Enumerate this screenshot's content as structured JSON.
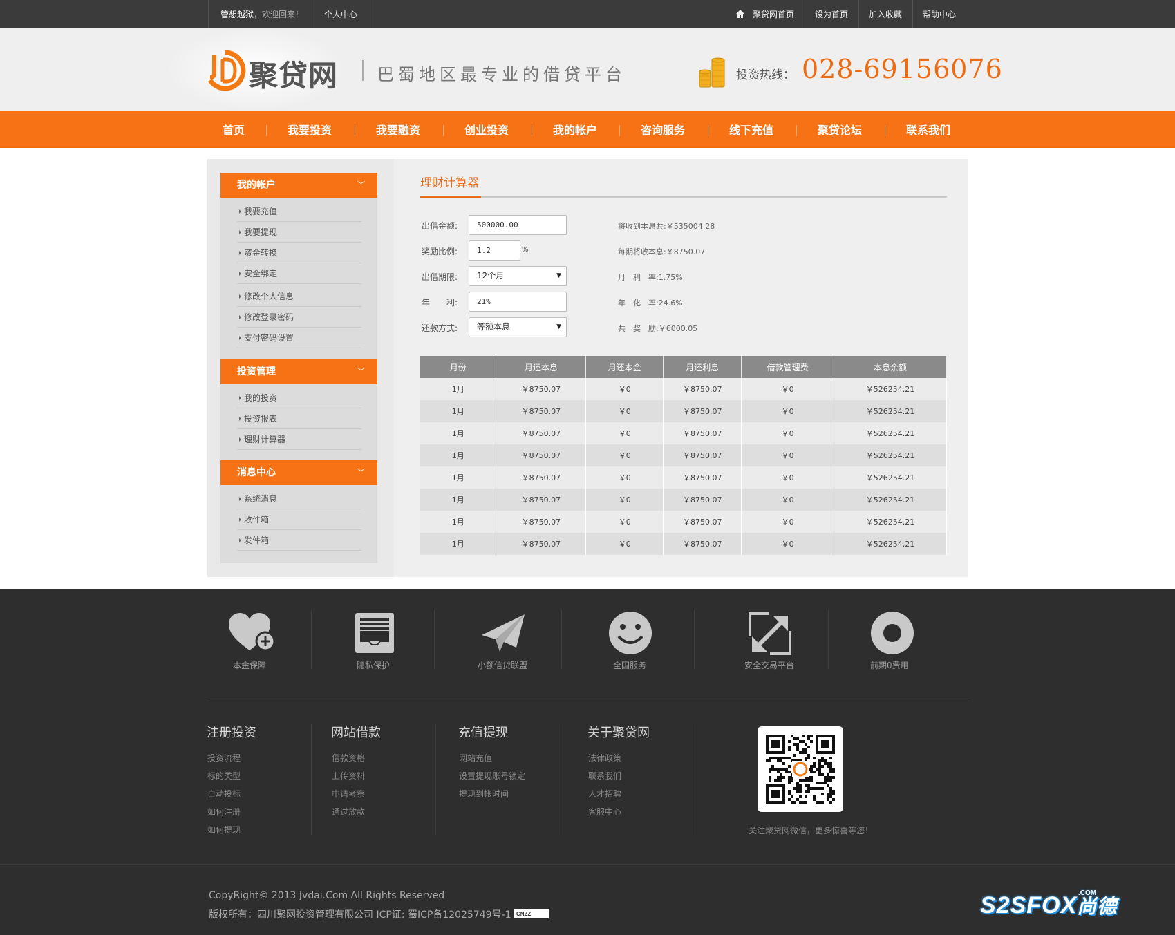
{
  "topbar": {
    "user": "管想越狱",
    "welcome": "，欢迎回来！",
    "personal_center": "个人中心",
    "home_link": "聚贷网首页",
    "set_home": "设为首页",
    "add_fav": "加入收藏",
    "help": "帮助中心"
  },
  "header": {
    "logo_text": "聚贷网",
    "slogan": "巴蜀地区最专业的借贷平台",
    "hotline_label": "投资热线：",
    "hotline_number": "028-69156076"
  },
  "nav": [
    "首页",
    "我要投资",
    "我要融资",
    "创业投资",
    "我的帐户",
    "咨询服务",
    "线下充值",
    "聚贷论坛",
    "联系我们"
  ],
  "sidebar": {
    "sections": [
      {
        "title": "我的帐户",
        "items": [
          "我要充值",
          "我要提现",
          "资金转换",
          "安全绑定",
          "修改个人信息",
          "修改登录密码",
          "支付密码设置"
        ]
      },
      {
        "title": "投资管理",
        "items": [
          "我的投资",
          "投资报表",
          "理财计算器"
        ]
      },
      {
        "title": "消息中心",
        "items": [
          "系统消息",
          "收件箱",
          "发件箱"
        ]
      }
    ],
    "chevron": "﹀"
  },
  "calculator": {
    "title": "理财计算器",
    "amount_label": "出借金额:",
    "amount_value": "500000.00",
    "reward_label": "奖励比例:",
    "reward_value": "1.2",
    "reward_unit": "%",
    "period_label": "出借期限:",
    "period_value": "12个月",
    "annual_label": "年　　利:",
    "annual_value": "21%",
    "method_label": "还款方式:",
    "method_value": "等额本息",
    "results": [
      {
        "label": "将收到本息共:",
        "value": "￥535004.28"
      },
      {
        "label": "每期将收本息:",
        "value": "￥8750.07"
      },
      {
        "label": "月　利　率:",
        "value": "1.75%"
      },
      {
        "label": "年　化　率:",
        "value": "24.6%"
      },
      {
        "label": "共　奖　励:",
        "value": "￥6000.05"
      }
    ]
  },
  "table": {
    "headers": [
      "月份",
      "月还本息",
      "月还本金",
      "月还利息",
      "借款管理费",
      "本息余额"
    ],
    "rows": [
      [
        "1月",
        "￥8750.07",
        "￥0",
        "￥8750.07",
        "￥0",
        "￥526254.21"
      ],
      [
        "1月",
        "￥8750.07",
        "￥0",
        "￥8750.07",
        "￥0",
        "￥526254.21"
      ],
      [
        "1月",
        "￥8750.07",
        "￥0",
        "￥8750.07",
        "￥0",
        "￥526254.21"
      ],
      [
        "1月",
        "￥8750.07",
        "￥0",
        "￥8750.07",
        "￥0",
        "￥526254.21"
      ],
      [
        "1月",
        "￥8750.07",
        "￥0",
        "￥8750.07",
        "￥0",
        "￥526254.21"
      ],
      [
        "1月",
        "￥8750.07",
        "￥0",
        "￥8750.07",
        "￥0",
        "￥526254.21"
      ],
      [
        "1月",
        "￥8750.07",
        "￥0",
        "￥8750.07",
        "￥0",
        "￥526254.21"
      ],
      [
        "1月",
        "￥8750.07",
        "￥0",
        "￥8750.07",
        "￥0",
        "￥526254.21"
      ]
    ]
  },
  "footer": {
    "features": [
      "本金保障",
      "隐私保护",
      "小额信贷联盟",
      "全国服务",
      "安全交易平台",
      "前期0费用"
    ],
    "columns": [
      {
        "title": "注册投资",
        "items": [
          "投资流程",
          "标的类型",
          "自动投标",
          "如何注册",
          "如何提现"
        ]
      },
      {
        "title": "网站借款",
        "items": [
          "借款资格",
          "上传资料",
          "申请考察",
          "通过放款"
        ]
      },
      {
        "title": "充值提现",
        "items": [
          "网站充值",
          "设置提现账号锁定",
          "提现到帐时间"
        ]
      },
      {
        "title": "关于聚贷网",
        "items": [
          "法律政策",
          "联系我们",
          "人才招聘",
          "客服中心"
        ]
      }
    ],
    "qr_caption": "关注聚贷网微信，更多惊喜等您！",
    "copyright": "CopyRight© 2013 Jvdai.Com All Rights Reserved",
    "icp": "版权所有：四川聚网投资管理有限公司 ICP证: 蜀ICP备12025749号-1",
    "cnzz": "CNZZ",
    "watermark": "S2SFOX",
    "watermark_cn": "尚德",
    "watermark_com": ".COM"
  },
  "colors": {
    "accent": "#f67214",
    "topbar": "#3b3b3b",
    "footer": "#2e2e2e"
  }
}
